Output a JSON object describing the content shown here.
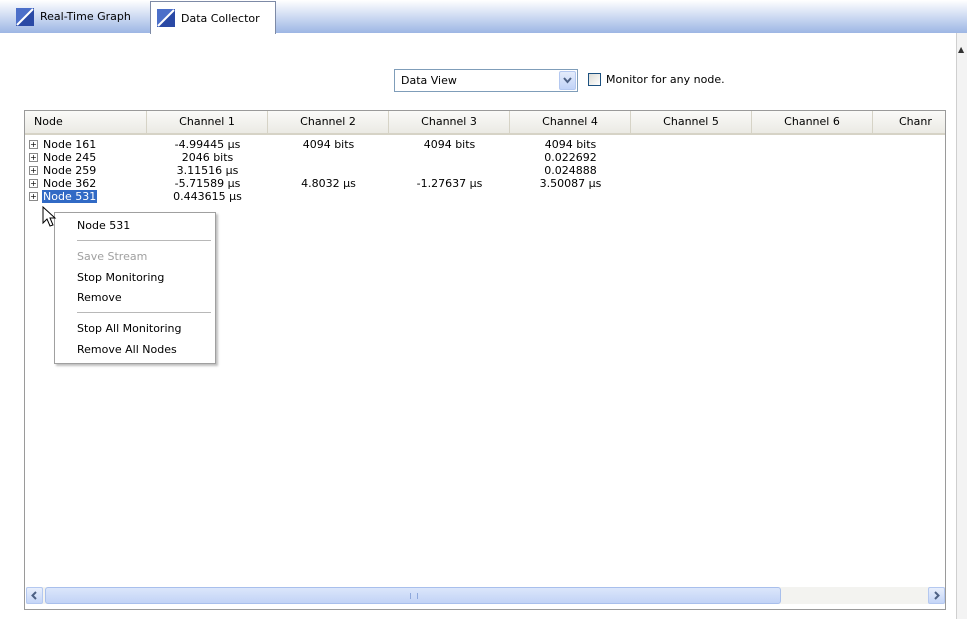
{
  "tabs": [
    {
      "label": "Real-Time Graph",
      "active": false
    },
    {
      "label": "Data Collector",
      "active": true
    }
  ],
  "toolbar": {
    "view_select": {
      "value": "Data View"
    },
    "monitor_any": {
      "label": "Monitor for any node.",
      "checked": false
    }
  },
  "grid": {
    "columns": [
      "Node",
      "Channel 1",
      "Channel 2",
      "Channel 3",
      "Channel 4",
      "Channel 5",
      "Channel 6",
      "Chanr"
    ],
    "rows": [
      {
        "node": "Node 161",
        "cells": [
          "-4.99445 µs",
          "4094 bits",
          "4094 bits",
          "4094 bits",
          "",
          "",
          ""
        ]
      },
      {
        "node": "Node 245",
        "cells": [
          "2046 bits",
          "",
          "",
          "0.022692",
          "",
          "",
          ""
        ]
      },
      {
        "node": "Node 259",
        "cells": [
          "3.11516 µs",
          "",
          "",
          "0.024888",
          "",
          "",
          ""
        ]
      },
      {
        "node": "Node 362",
        "cells": [
          "-5.71589 µs",
          "4.8032 µs",
          "-1.27637 µs",
          "3.50087 µs",
          "",
          "",
          ""
        ]
      },
      {
        "node": "Node 531",
        "cells": [
          "0.443615 µs",
          "",
          "",
          "",
          "",
          "",
          ""
        ],
        "selected": true
      }
    ]
  },
  "context_menu": {
    "title": "Node 531",
    "items": [
      {
        "label": "Save Stream",
        "enabled": false
      },
      {
        "label": "Stop Monitoring",
        "enabled": true
      },
      {
        "label": "Remove",
        "enabled": true
      },
      {
        "label": "Stop All Monitoring",
        "enabled": true
      },
      {
        "label": "Remove All Nodes",
        "enabled": true
      }
    ]
  },
  "colors": {
    "selection": "#316ac5",
    "tabstrip": "#9db6e4",
    "disabled_text": "#a0a0a0"
  }
}
